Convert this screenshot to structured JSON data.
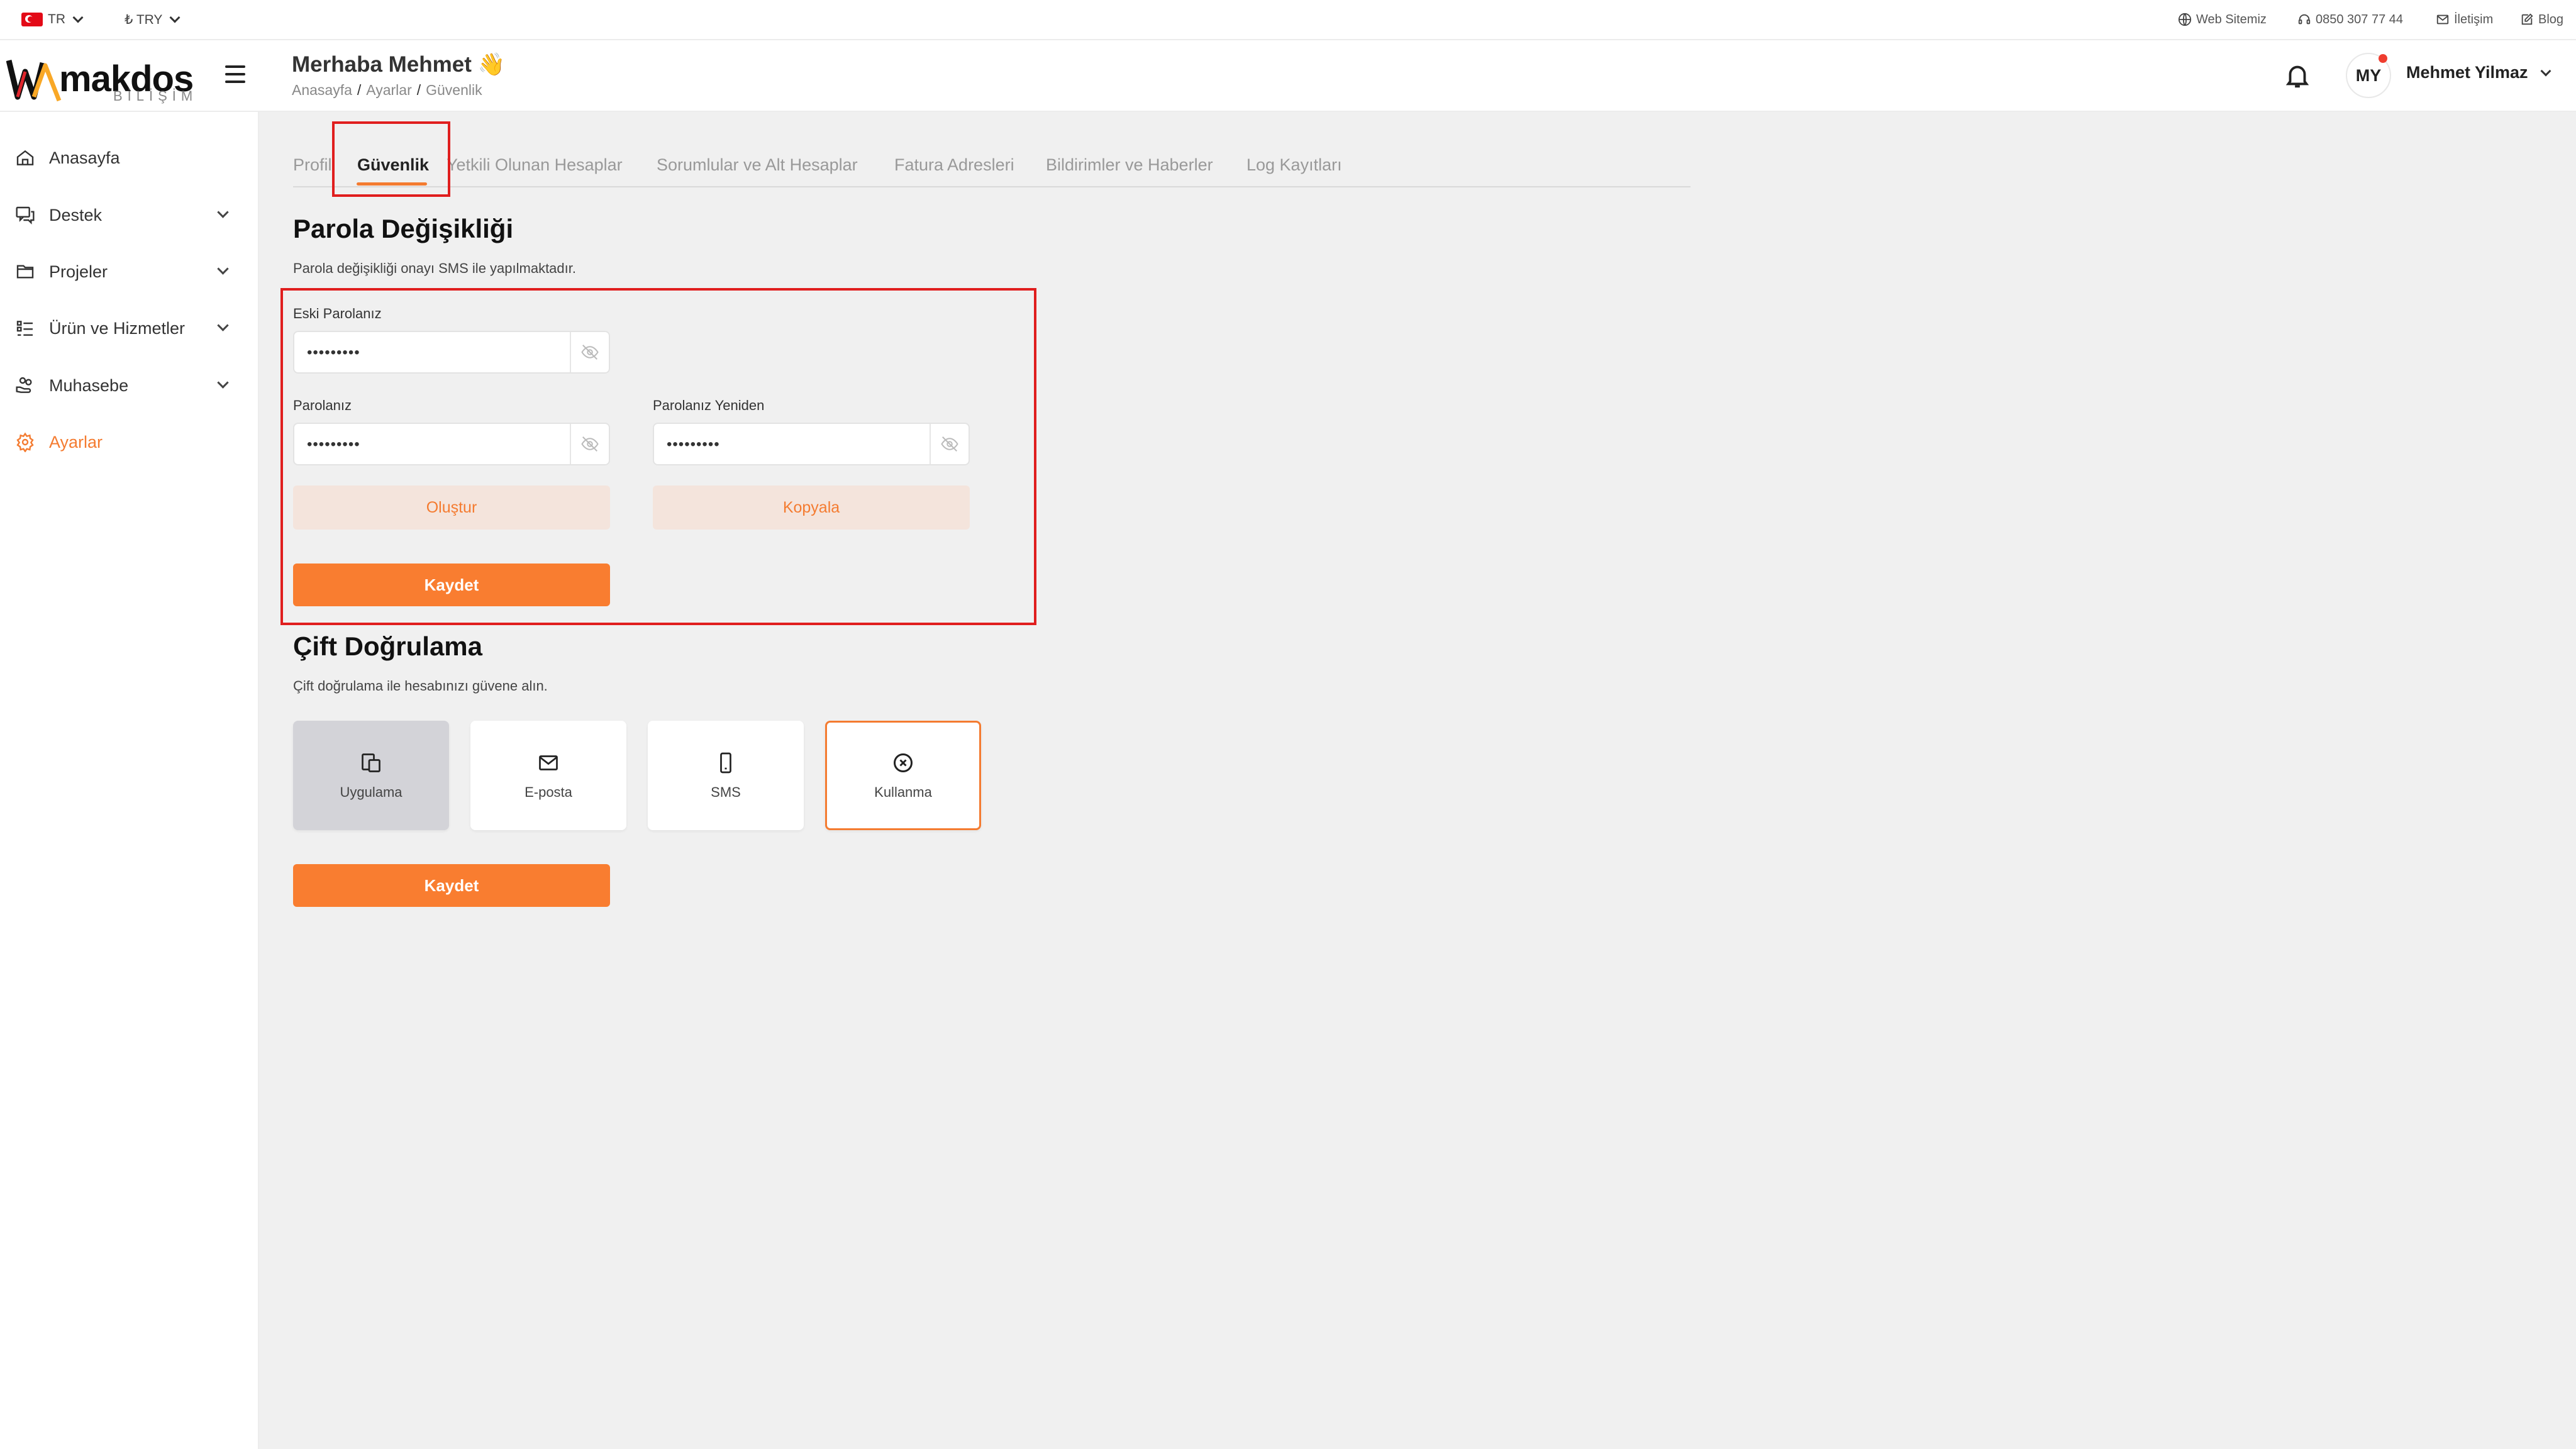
{
  "topbar": {
    "language": "TR",
    "currency": "₺ TRY",
    "links": [
      "Web Sitemiz",
      "0850 307 77 44",
      "İletişim",
      "Blog"
    ]
  },
  "header": {
    "logo_text": "makdos",
    "logo_sub": "BİLİŞİM",
    "greeting": "Merhaba Mehmet 👋",
    "breadcrumb": [
      "Anasayfa",
      "Ayarlar",
      "Güvenlik"
    ],
    "avatar_initials": "MY",
    "user_name": "Mehmet Yilmaz"
  },
  "sidebar": {
    "items": [
      {
        "label": "Anasayfa",
        "icon": "home-icon"
      },
      {
        "label": "Destek",
        "icon": "chat-icon"
      },
      {
        "label": "Projeler",
        "icon": "folder-icon"
      },
      {
        "label": "Ürün ve Hizmetler",
        "icon": "list-icon"
      },
      {
        "label": "Muhasebe",
        "icon": "hand-coins-icon"
      },
      {
        "label": "Ayarlar",
        "icon": "gear-icon"
      }
    ]
  },
  "tabs": [
    "Profil",
    "Güvenlik",
    "Yetkili Olunan Hesaplar",
    "Sorumlular ve Alt Hesaplar",
    "Fatura Adresleri",
    "Bildirimler ve Haberler",
    "Log Kayıtları"
  ],
  "password": {
    "title": "Parola Değişikliği",
    "description": "Parola değişikliği onayı SMS ile yapılmaktadır.",
    "old_label": "Eski Parolanız",
    "old_value": "•••••••••",
    "new_label": "Parolanız",
    "new_value": "•••••••••",
    "repeat_label": "Parolanız Yeniden",
    "repeat_value": "•••••••••",
    "generate_label": "Oluştur",
    "copy_label": "Kopyala",
    "save_label": "Kaydet"
  },
  "twofa": {
    "title": "Çift Doğrulama",
    "description": "Çift doğrulama ile hesabınızı güvene alın.",
    "options": [
      "Uygulama",
      "E-posta",
      "SMS",
      "Kullanma"
    ],
    "save_label": "Kaydet"
  },
  "colors": {
    "accent": "#f97d30",
    "highlight": "#e01e1e"
  }
}
